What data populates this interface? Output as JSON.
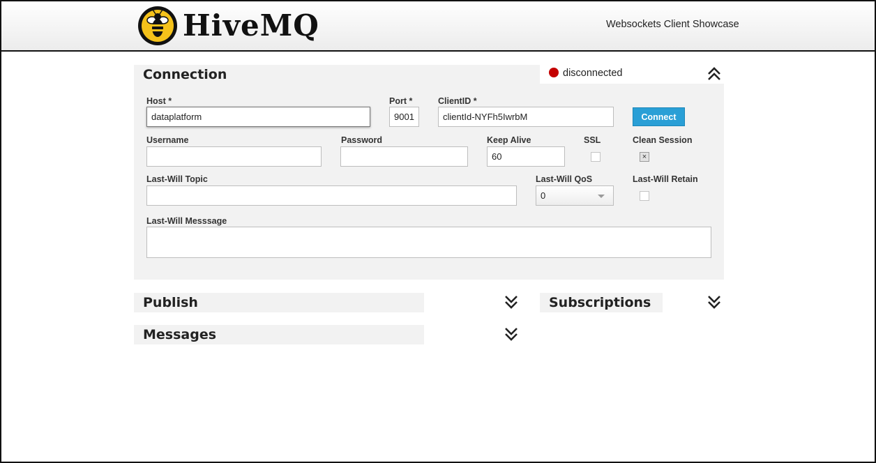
{
  "header": {
    "logo_text": "HiveMQ",
    "subtitle": "Websockets Client Showcase"
  },
  "connection": {
    "title": "Connection",
    "status": "disconnected",
    "status_color": "#c40000",
    "collapse_icon": "chevron-double-up-icon",
    "connect_label": "Connect",
    "fields": {
      "host_label": "Host *",
      "host_value": "dataplatform",
      "port_label": "Port *",
      "port_value": "9001",
      "clientid_label": "ClientID *",
      "clientid_value": "clientId-NYFh5IwrbM",
      "username_label": "Username",
      "username_value": "",
      "password_label": "Password",
      "password_value": "",
      "keepalive_label": "Keep Alive",
      "keepalive_value": "60",
      "ssl_label": "SSL",
      "ssl_checked": false,
      "clean_session_label": "Clean Session",
      "clean_session_checked": true,
      "clean_session_mark": "×",
      "lastwill_topic_label": "Last-Will Topic",
      "lastwill_topic_value": "",
      "lastwill_qos_label": "Last-Will QoS",
      "lastwill_qos_value": "0",
      "lastwill_retain_label": "Last-Will Retain",
      "lastwill_retain_checked": false,
      "lastwill_message_label": "Last-Will Messsage",
      "lastwill_message_value": ""
    }
  },
  "publish": {
    "title": "Publish",
    "expand_icon": "chevron-double-down-icon"
  },
  "subscriptions": {
    "title": "Subscriptions",
    "expand_icon": "chevron-double-down-icon"
  },
  "messages": {
    "title": "Messages",
    "expand_icon": "chevron-double-down-icon"
  },
  "colors": {
    "accent": "#2a9fd6",
    "panel": "#f2f2f2",
    "logo_yellow": "#f5c21a"
  }
}
